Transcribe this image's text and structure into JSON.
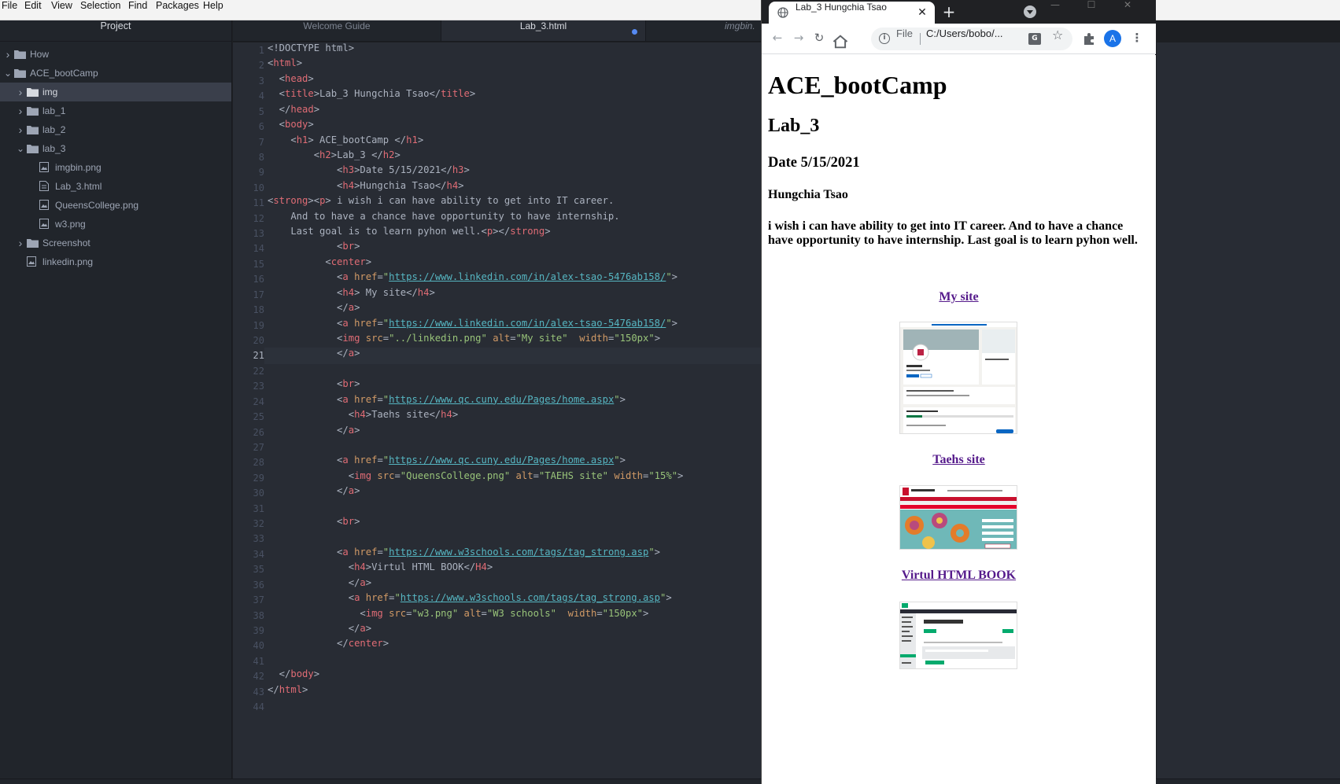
{
  "menubar": {
    "items": [
      "File",
      "Edit",
      "View",
      "Selection",
      "Find",
      "Packages",
      "Help"
    ]
  },
  "tree": {
    "title": "Project",
    "items": [
      {
        "label": "How",
        "kind": "folder",
        "expanded": false
      },
      {
        "label": "ACE_bootCamp",
        "kind": "folder",
        "expanded": true
      },
      {
        "label": "img",
        "kind": "folder",
        "expanded": false,
        "selected": true
      },
      {
        "label": "lab_1",
        "kind": "folder",
        "expanded": false
      },
      {
        "label": "lab_2",
        "kind": "folder",
        "expanded": false
      },
      {
        "label": "lab_3",
        "kind": "folder",
        "expanded": true
      },
      {
        "label": "imgbin.png",
        "kind": "image"
      },
      {
        "label": "Lab_3.html",
        "kind": "file"
      },
      {
        "label": "QueensCollege.png",
        "kind": "image"
      },
      {
        "label": "w3.png",
        "kind": "image"
      },
      {
        "label": "Screenshot",
        "kind": "folder",
        "expanded": false
      },
      {
        "label": "linkedin.png",
        "kind": "image"
      }
    ]
  },
  "editor": {
    "tabs": [
      {
        "label": "Welcome Guide",
        "active": false
      },
      {
        "label": "Lab_3.html",
        "active": true,
        "modified": true
      },
      {
        "label": "imgbin.",
        "active": false
      }
    ],
    "current_line": 21,
    "lines": [
      [
        [
          "p",
          "<!DOCTYPE html>"
        ]
      ],
      [
        [
          "p",
          "<"
        ],
        [
          "t",
          "html"
        ],
        [
          "p",
          ">"
        ]
      ],
      [
        [
          "p",
          "  <"
        ],
        [
          "t",
          "head"
        ],
        [
          "p",
          ">"
        ]
      ],
      [
        [
          "p",
          "  <"
        ],
        [
          "t",
          "title"
        ],
        [
          "p",
          ">Lab_3 Hungchia Tsao</"
        ],
        [
          "t",
          "title"
        ],
        [
          "p",
          ">"
        ]
      ],
      [
        [
          "p",
          "  </"
        ],
        [
          "t",
          "head"
        ],
        [
          "p",
          ">"
        ]
      ],
      [
        [
          "p",
          "  <"
        ],
        [
          "t",
          "body"
        ],
        [
          "p",
          ">"
        ]
      ],
      [
        [
          "p",
          "    <"
        ],
        [
          "t",
          "h1"
        ],
        [
          "p",
          "> ACE_bootCamp </"
        ],
        [
          "t",
          "h1"
        ],
        [
          "p",
          ">"
        ]
      ],
      [
        [
          "p",
          "        <"
        ],
        [
          "t",
          "h2"
        ],
        [
          "p",
          ">Lab_3 </"
        ],
        [
          "t",
          "h2"
        ],
        [
          "p",
          ">"
        ]
      ],
      [
        [
          "p",
          "            <"
        ],
        [
          "t",
          "h3"
        ],
        [
          "p",
          ">Date 5/15/2021</"
        ],
        [
          "t",
          "h3"
        ],
        [
          "p",
          ">"
        ]
      ],
      [
        [
          "p",
          "            <"
        ],
        [
          "t",
          "h4"
        ],
        [
          "p",
          ">Hungchia Tsao</"
        ],
        [
          "t",
          "h4"
        ],
        [
          "p",
          ">"
        ]
      ],
      [
        [
          "p",
          "<"
        ],
        [
          "t",
          "strong"
        ],
        [
          "p",
          "><"
        ],
        [
          "t",
          "p"
        ],
        [
          "p",
          "> i wish i can have ability to get into IT career."
        ]
      ],
      [
        [
          "p",
          "    And to have a chance have opportunity to have internship."
        ]
      ],
      [
        [
          "p",
          "    Last goal is to learn pyhon well.<"
        ],
        [
          "t",
          "p"
        ],
        [
          "p",
          "></"
        ],
        [
          "t",
          "strong"
        ],
        [
          "p",
          ">"
        ]
      ],
      [
        [
          "p",
          "            <"
        ],
        [
          "t",
          "br"
        ],
        [
          "p",
          ">"
        ]
      ],
      [
        [
          "p",
          "          <"
        ],
        [
          "t",
          "center"
        ],
        [
          "p",
          ">"
        ]
      ],
      [
        [
          "p",
          "            <"
        ],
        [
          "t",
          "a"
        ],
        [
          "p",
          " "
        ],
        [
          "a",
          "href"
        ],
        [
          "p",
          "="
        ],
        [
          "s",
          "\""
        ],
        [
          "u",
          "https://www.linkedin.com/in/alex-tsao-5476ab158/"
        ],
        [
          "s",
          "\""
        ],
        [
          "p",
          ">"
        ]
      ],
      [
        [
          "p",
          "            <"
        ],
        [
          "t",
          "h4"
        ],
        [
          "p",
          "> My site</"
        ],
        [
          "t",
          "h4"
        ],
        [
          "p",
          ">"
        ]
      ],
      [
        [
          "p",
          "            </"
        ],
        [
          "t",
          "a"
        ],
        [
          "p",
          ">"
        ]
      ],
      [
        [
          "p",
          "            <"
        ],
        [
          "t",
          "a"
        ],
        [
          "p",
          " "
        ],
        [
          "a",
          "href"
        ],
        [
          "p",
          "="
        ],
        [
          "s",
          "\""
        ],
        [
          "u",
          "https://www.linkedin.com/in/alex-tsao-5476ab158/"
        ],
        [
          "s",
          "\""
        ],
        [
          "p",
          ">"
        ]
      ],
      [
        [
          "p",
          "            <"
        ],
        [
          "t",
          "img"
        ],
        [
          "p",
          " "
        ],
        [
          "a",
          "src"
        ],
        [
          "p",
          "="
        ],
        [
          "s",
          "\"../linkedin.png\""
        ],
        [
          "p",
          " "
        ],
        [
          "a",
          "alt"
        ],
        [
          "p",
          "="
        ],
        [
          "s",
          "\"My site\""
        ],
        [
          "p",
          "  "
        ],
        [
          "a",
          "width"
        ],
        [
          "p",
          "="
        ],
        [
          "s",
          "\"150px\""
        ],
        [
          "p",
          ">"
        ]
      ],
      [
        [
          "p",
          "            </"
        ],
        [
          "t",
          "a"
        ],
        [
          "p",
          ">"
        ]
      ],
      [],
      [
        [
          "p",
          "            <"
        ],
        [
          "t",
          "br"
        ],
        [
          "p",
          ">"
        ]
      ],
      [
        [
          "p",
          "            <"
        ],
        [
          "t",
          "a"
        ],
        [
          "p",
          " "
        ],
        [
          "a",
          "href"
        ],
        [
          "p",
          "="
        ],
        [
          "s",
          "\""
        ],
        [
          "u",
          "https://www.qc.cuny.edu/Pages/home.aspx"
        ],
        [
          "s",
          "\""
        ],
        [
          "p",
          ">"
        ]
      ],
      [
        [
          "p",
          "              <"
        ],
        [
          "t",
          "h4"
        ],
        [
          "p",
          ">Taehs site</"
        ],
        [
          "t",
          "h4"
        ],
        [
          "p",
          ">"
        ]
      ],
      [
        [
          "p",
          "            </"
        ],
        [
          "t",
          "a"
        ],
        [
          "p",
          ">"
        ]
      ],
      [],
      [
        [
          "p",
          "            <"
        ],
        [
          "t",
          "a"
        ],
        [
          "p",
          " "
        ],
        [
          "a",
          "href"
        ],
        [
          "p",
          "="
        ],
        [
          "s",
          "\""
        ],
        [
          "u",
          "https://www.qc.cuny.edu/Pages/home.aspx"
        ],
        [
          "s",
          "\""
        ],
        [
          "p",
          ">"
        ]
      ],
      [
        [
          "p",
          "              <"
        ],
        [
          "t",
          "img"
        ],
        [
          "p",
          " "
        ],
        [
          "a",
          "src"
        ],
        [
          "p",
          "="
        ],
        [
          "s",
          "\"QueensCollege.png\""
        ],
        [
          "p",
          " "
        ],
        [
          "a",
          "alt"
        ],
        [
          "p",
          "="
        ],
        [
          "s",
          "\"TAEHS site\""
        ],
        [
          "p",
          " "
        ],
        [
          "a",
          "width"
        ],
        [
          "p",
          "="
        ],
        [
          "s",
          "\"15%\""
        ],
        [
          "p",
          ">"
        ]
      ],
      [
        [
          "p",
          "            </"
        ],
        [
          "t",
          "a"
        ],
        [
          "p",
          ">"
        ]
      ],
      [],
      [
        [
          "p",
          "            <"
        ],
        [
          "t",
          "br"
        ],
        [
          "p",
          ">"
        ]
      ],
      [],
      [
        [
          "p",
          "            <"
        ],
        [
          "t",
          "a"
        ],
        [
          "p",
          " "
        ],
        [
          "a",
          "href"
        ],
        [
          "p",
          "="
        ],
        [
          "s",
          "\""
        ],
        [
          "u",
          "https://www.w3schools.com/tags/tag_strong.asp"
        ],
        [
          "s",
          "\""
        ],
        [
          "p",
          ">"
        ]
      ],
      [
        [
          "p",
          "              <"
        ],
        [
          "t",
          "h4"
        ],
        [
          "p",
          ">Virtul HTML BOOK</"
        ],
        [
          "t",
          "H4"
        ],
        [
          "p",
          ">"
        ]
      ],
      [
        [
          "p",
          "              </"
        ],
        [
          "t",
          "a"
        ],
        [
          "p",
          ">"
        ]
      ],
      [
        [
          "p",
          "              <"
        ],
        [
          "t",
          "a"
        ],
        [
          "p",
          " "
        ],
        [
          "a",
          "href"
        ],
        [
          "p",
          "="
        ],
        [
          "s",
          "\""
        ],
        [
          "u",
          "https://www.w3schools.com/tags/tag_strong.asp"
        ],
        [
          "s",
          "\""
        ],
        [
          "p",
          ">"
        ]
      ],
      [
        [
          "p",
          "                <"
        ],
        [
          "t",
          "img"
        ],
        [
          "p",
          " "
        ],
        [
          "a",
          "src"
        ],
        [
          "p",
          "="
        ],
        [
          "s",
          "\"w3.png\""
        ],
        [
          "p",
          " "
        ],
        [
          "a",
          "alt"
        ],
        [
          "p",
          "="
        ],
        [
          "s",
          "\"W3 schools\""
        ],
        [
          "p",
          "  "
        ],
        [
          "a",
          "width"
        ],
        [
          "p",
          "="
        ],
        [
          "s",
          "\"150px\""
        ],
        [
          "p",
          ">"
        ]
      ],
      [
        [
          "p",
          "              </"
        ],
        [
          "t",
          "a"
        ],
        [
          "p",
          ">"
        ]
      ],
      [
        [
          "p",
          "            </"
        ],
        [
          "t",
          "center"
        ],
        [
          "p",
          ">"
        ]
      ],
      [],
      [
        [
          "p",
          "  </"
        ],
        [
          "t",
          "body"
        ],
        [
          "p",
          ">"
        ]
      ],
      [
        [
          "p",
          "</"
        ],
        [
          "t",
          "html"
        ],
        [
          "p",
          ">"
        ]
      ],
      []
    ]
  },
  "browser": {
    "tab_title": "Lab_3 Hungchia Tsao",
    "tab_close": "✕",
    "new_tab": "+",
    "url_scheme": "File",
    "url": "C:/Users/bobo/...",
    "avatar_letter": "A",
    "window_controls": [
      "—",
      "☐",
      "✕"
    ],
    "page": {
      "h1": "ACE_bootCamp",
      "h2": "Lab_3",
      "h3": "Date 5/15/2021",
      "h4": "Hungchia Tsao",
      "paragraph": "i wish i can have ability to get into IT career. And to have a chance have opportunity to have internship. Last goal is to learn pyhon well.",
      "links": [
        {
          "label": "My site"
        },
        {
          "label": "Taehs site"
        },
        {
          "label": "Virtul HTML BOOK"
        }
      ]
    }
  },
  "colors": {
    "editor_bg": "#282c34",
    "tree_bg": "#21252b",
    "tag": "#e06c75",
    "attribute": "#d19a66",
    "string": "#98c379",
    "link": "#551a8b",
    "accent": "#568af2"
  }
}
